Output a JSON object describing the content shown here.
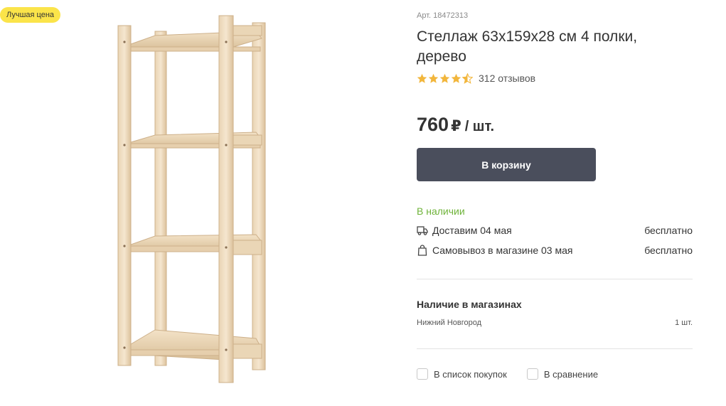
{
  "badge": "Лучшая цена",
  "product": {
    "article": "Арт. 18472313",
    "title": "Стеллаж 63x159x28 см 4 полки, дерево",
    "rating": 4.5,
    "reviews": "312 отзывов"
  },
  "price": {
    "value": "760",
    "currency": "₽",
    "unit": "/ шт."
  },
  "cart_button": "В корзину",
  "availability": {
    "status": "В наличии",
    "delivery": {
      "label": "Доставим 04 мая",
      "cost": "бесплатно",
      "icon": "truck-icon"
    },
    "pickup": {
      "label": "Самовывоз в магазине 03 мая",
      "cost": "бесплатно",
      "icon": "shopping-bag-icon"
    }
  },
  "stores": {
    "title": "Наличие в магазинах",
    "items": [
      {
        "city": "Нижний Новгород",
        "qty": "1 шт."
      }
    ]
  },
  "actions": {
    "shopping_list": "В список покупок",
    "compare": "В сравнение"
  },
  "colors": {
    "badge": "#fbe44a",
    "button": "#4a4e5c",
    "in_stock": "#6fb33a",
    "star": "#f2b63c"
  }
}
